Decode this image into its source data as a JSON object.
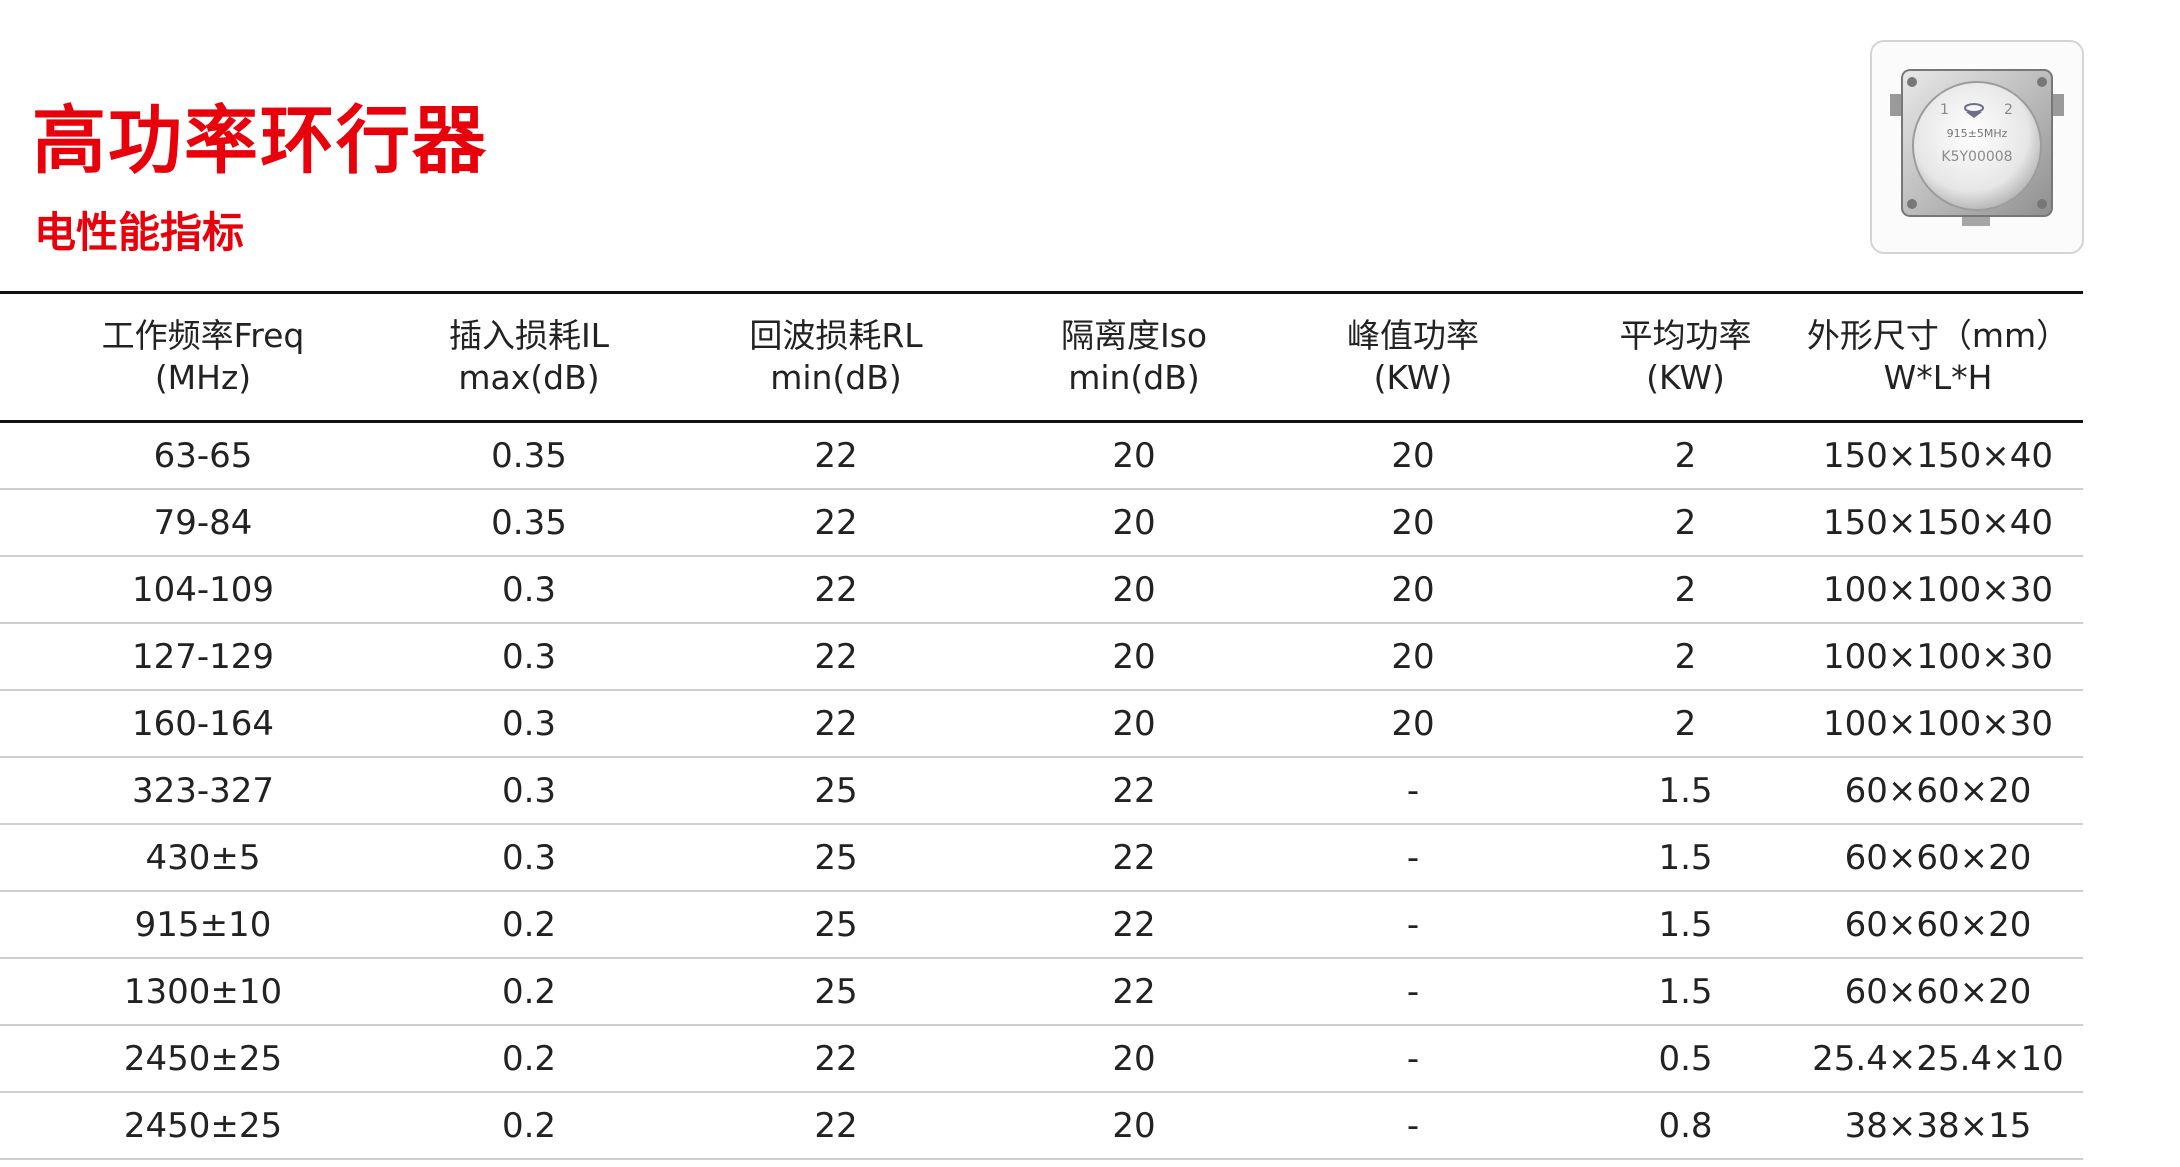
{
  "header": {
    "title": "高功率环行器",
    "subtitle": "电性能指标"
  },
  "product_image": {
    "port_1": "1",
    "port_2": "2",
    "spec_label": "915±5MHz",
    "serial": "K5Y00008"
  },
  "table": {
    "headers": [
      {
        "line1": "工作频率Freq",
        "line2": "(MHz)"
      },
      {
        "line1": "插入损耗IL",
        "line2": "max(dB)"
      },
      {
        "line1": "回波损耗RL",
        "line2": "min(dB)"
      },
      {
        "line1": "隔离度Iso",
        "line2": "min(dB)"
      },
      {
        "line1": "峰值功率",
        "line2": "(KW)"
      },
      {
        "line1": "平均功率",
        "line2": "(KW)"
      },
      {
        "line1": "外形尺寸（mm）",
        "line2": "W*L*H"
      }
    ],
    "rows": [
      [
        "63-65",
        "0.35",
        "22",
        "20",
        "20",
        "2",
        "150×150×40"
      ],
      [
        "79-84",
        "0.35",
        "22",
        "20",
        "20",
        "2",
        "150×150×40"
      ],
      [
        "104-109",
        "0.3",
        "22",
        "20",
        "20",
        "2",
        "100×100×30"
      ],
      [
        "127-129",
        "0.3",
        "22",
        "20",
        "20",
        "2",
        "100×100×30"
      ],
      [
        "160-164",
        "0.3",
        "22",
        "20",
        "20",
        "2",
        "100×100×30"
      ],
      [
        "323-327",
        "0.3",
        "25",
        "22",
        "-",
        "1.5",
        "60×60×20"
      ],
      [
        "430±5",
        "0.3",
        "25",
        "22",
        "-",
        "1.5",
        "60×60×20"
      ],
      [
        "915±10",
        "0.2",
        "25",
        "22",
        "-",
        "1.5",
        "60×60×20"
      ],
      [
        "1300±10",
        "0.2",
        "25",
        "22",
        "-",
        "1.5",
        "60×60×20"
      ],
      [
        "2450±25",
        "0.2",
        "22",
        "20",
        "-",
        "0.5",
        "25.4×25.4×10"
      ],
      [
        "2450±25",
        "0.2",
        "22",
        "20",
        "-",
        "0.8",
        "38×38×15"
      ]
    ]
  }
}
